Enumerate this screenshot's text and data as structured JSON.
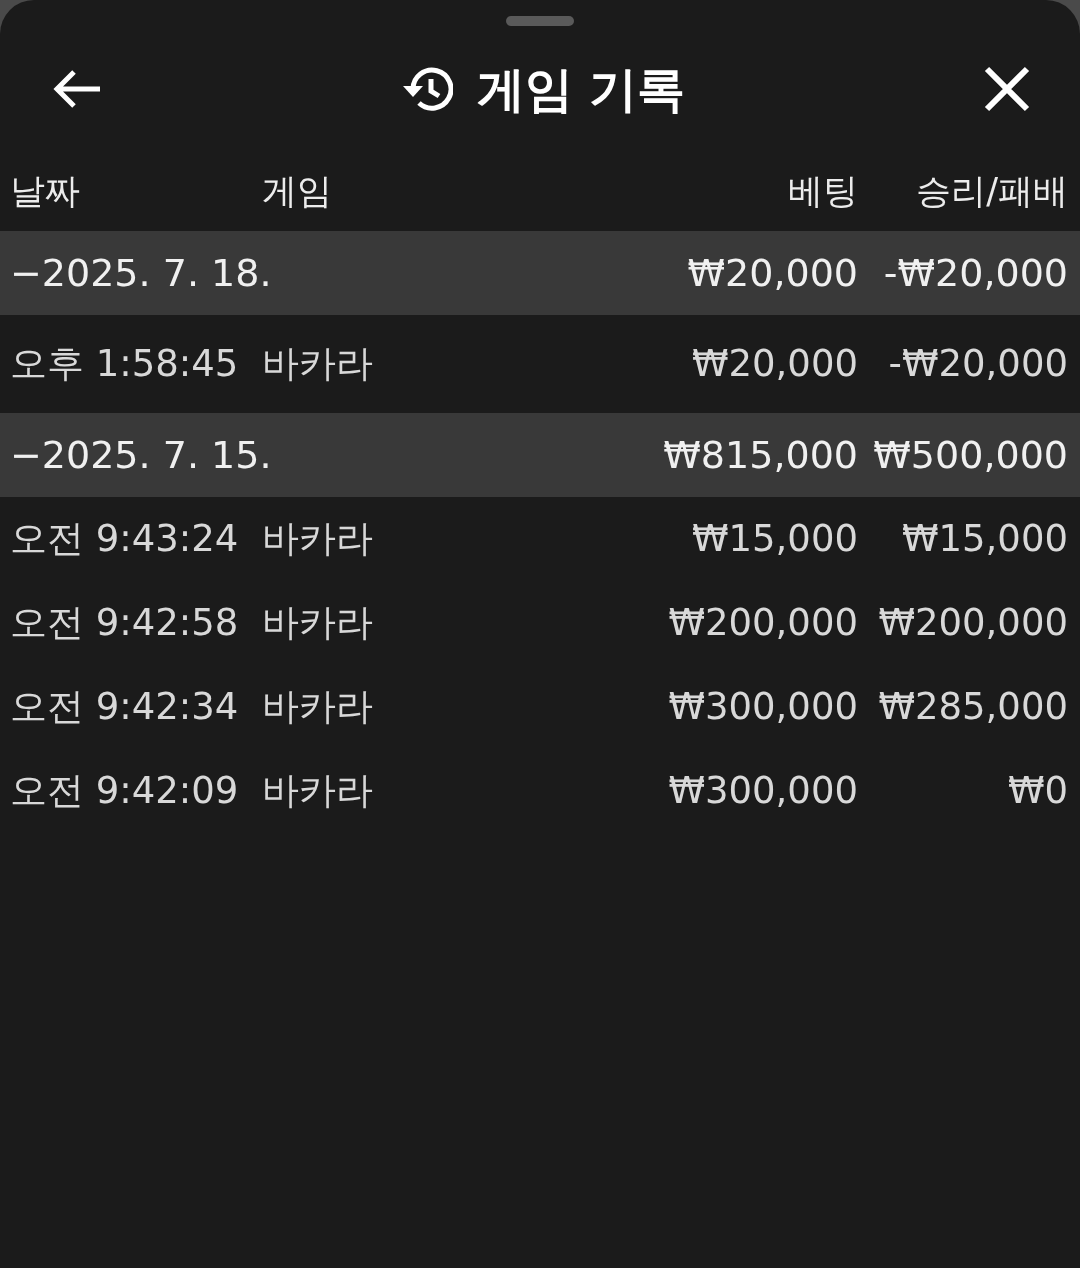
{
  "header": {
    "title": "게임 기록"
  },
  "columns": [
    "날짜",
    "게임",
    "베팅",
    "승리/패배"
  ],
  "groups": [
    {
      "label": "−2025. 7. 18.",
      "bet": "₩20,000",
      "result": "-₩20,000",
      "rows": [
        {
          "time": "오후 1:58:45",
          "game": "바카라",
          "bet": "₩20,000",
          "result": "-₩20,000"
        }
      ]
    },
    {
      "label": "−2025. 7. 15.",
      "bet": "₩815,000",
      "result": "₩500,000",
      "rows": [
        {
          "time": "오전 9:43:24",
          "game": "바카라",
          "bet": "₩15,000",
          "result": "₩15,000"
        },
        {
          "time": "오전 9:42:58",
          "game": "바카라",
          "bet": "₩200,000",
          "result": "₩200,000"
        },
        {
          "time": "오전 9:42:34",
          "game": "바카라",
          "bet": "₩300,000",
          "result": "₩285,000"
        },
        {
          "time": "오전 9:42:09",
          "game": "바카라",
          "bet": "₩300,000",
          "result": "₩0"
        }
      ]
    }
  ]
}
